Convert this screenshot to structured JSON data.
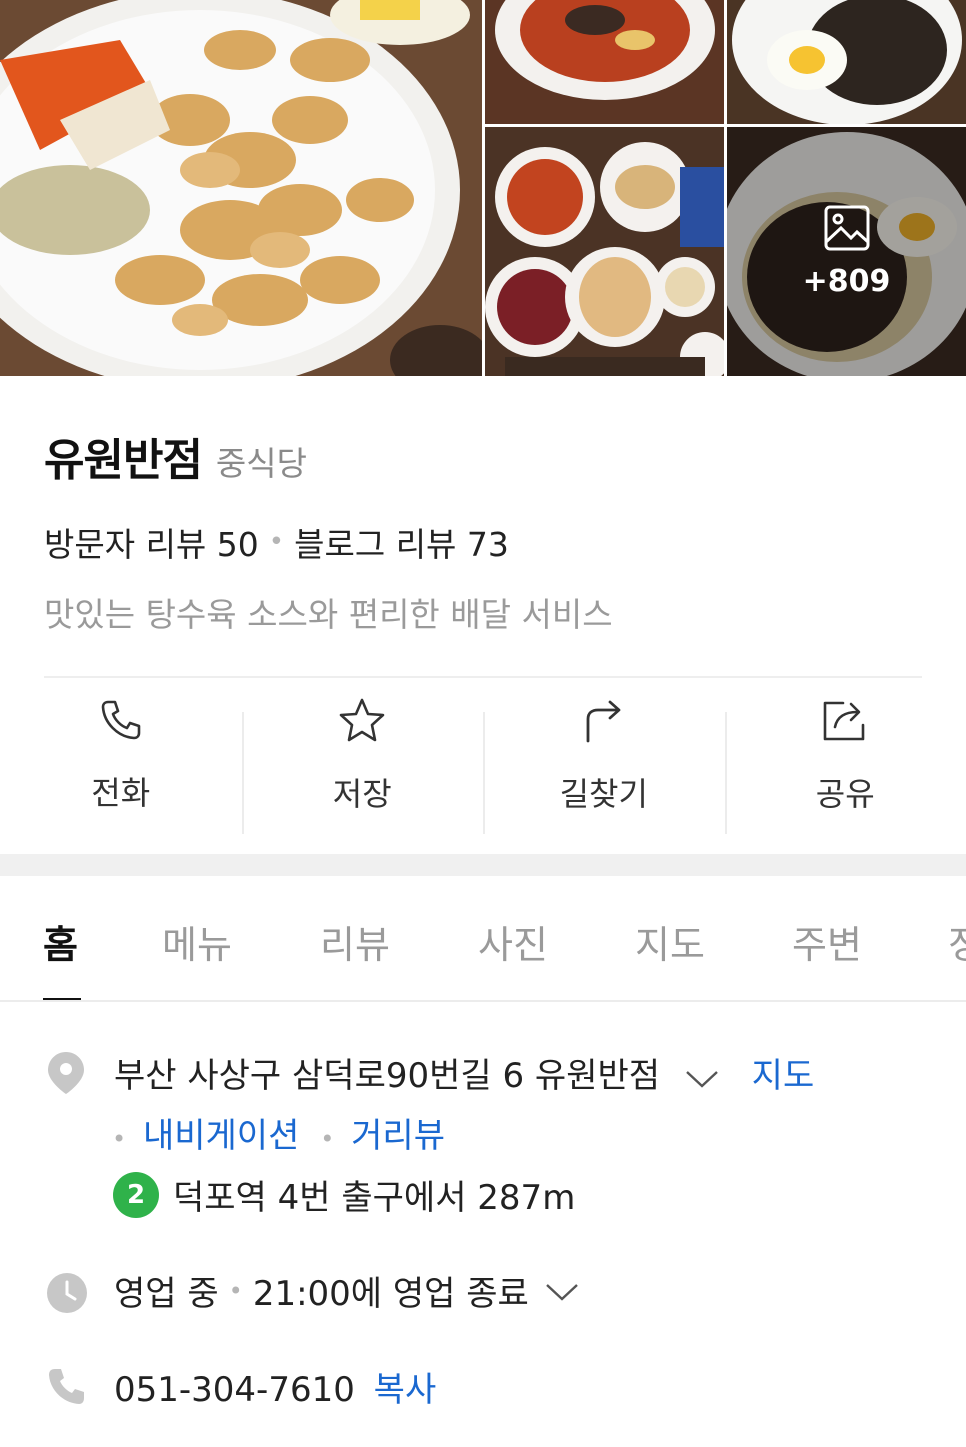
{
  "gallery": {
    "more_count": "+809"
  },
  "place": {
    "name": "유원반점",
    "category": "중식당",
    "visitor_reviews": "방문자 리뷰 50",
    "blog_reviews": "블로그 리뷰 73",
    "separator": "•",
    "tagline": "맛있는 탕수육 소스와 편리한 배달 서비스"
  },
  "actions": [
    {
      "label": "전화",
      "icon": "phone-icon"
    },
    {
      "label": "저장",
      "icon": "star-icon"
    },
    {
      "label": "길찾기",
      "icon": "directions-icon"
    },
    {
      "label": "공유",
      "icon": "share-icon"
    }
  ],
  "tabs": [
    {
      "label": "홈",
      "active": true
    },
    {
      "label": "메뉴"
    },
    {
      "label": "리뷰"
    },
    {
      "label": "사진"
    },
    {
      "label": "지도"
    },
    {
      "label": "주변"
    },
    {
      "label": "정"
    }
  ],
  "detail": {
    "address": "부산 사상구 삼덕로90번길 6 유원반점",
    "map_link": "지도",
    "navigation_link": "내비게이션",
    "streetview_link": "거리뷰",
    "subway_line": "2",
    "subway_text": "덕포역 4번 출구에서 287m",
    "hours_status": "영업 중",
    "hours_close": "21:00에 영업 종료",
    "phone": "051-304-7610",
    "copy_link": "복사"
  },
  "colors": {
    "link": "#1a68d0",
    "subway_line_2": "#2fb24a"
  }
}
